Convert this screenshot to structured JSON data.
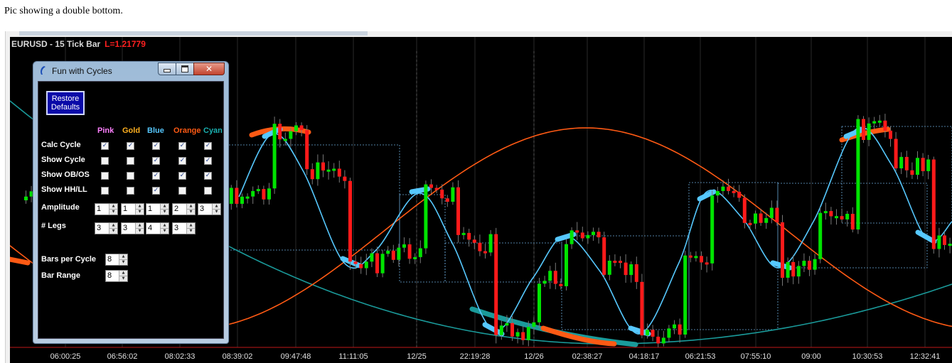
{
  "caption": "Pic showing a double bottom.",
  "chart": {
    "symbol_title": "EURUSD - 15 Tick Bar",
    "last_price_label": "L=1.21779",
    "time_axis": [
      "06:00:25",
      "06:56:02",
      "08:02:33",
      "08:39:02",
      "09:47:48",
      "11:11:05",
      "12/25",
      "22:19:28",
      "12/26",
      "02:38:27",
      "04:18:17",
      "06:21:53",
      "07:55:10",
      "09:00",
      "10:30:53",
      "12:32:41"
    ],
    "colors": {
      "up": "#00e400",
      "down": "#ff1a1a",
      "pink": "#ff80ff",
      "gold": "#ffb020",
      "blue": "#56c8ff",
      "orange": "#ff5a14",
      "cyan": "#1a9a9a"
    }
  },
  "dialog": {
    "title": "Fun with Cycles",
    "restore_button": "Restore Defaults",
    "columns": [
      "Pink",
      "Gold",
      "Blue",
      "Orange",
      "Cyan"
    ],
    "column_colors": [
      "#ff80ff",
      "#ffb020",
      "#56c8ff",
      "#ff5a14",
      "#1ab0b0"
    ],
    "rows": [
      {
        "label": "Calc Cycle",
        "checked": [
          true,
          true,
          true,
          true,
          true
        ]
      },
      {
        "label": "Show Cycle",
        "checked": [
          false,
          false,
          true,
          true,
          true
        ]
      },
      {
        "label": "Show OB/OS",
        "checked": [
          false,
          false,
          true,
          true,
          true
        ]
      },
      {
        "label": "Show HH/LL",
        "checked": [
          false,
          false,
          true,
          false,
          false
        ]
      }
    ],
    "amplitude": {
      "label": "Amplitude",
      "values": [
        "1",
        "1",
        "1",
        "2",
        "3"
      ]
    },
    "legs": {
      "label": "# Legs",
      "values": [
        "3",
        "3",
        "4",
        "3"
      ]
    },
    "bars_per_cycle": {
      "label": "Bars per Cycle",
      "value": "8"
    },
    "bar_range": {
      "label": "Bar Range",
      "value": "8"
    }
  }
}
